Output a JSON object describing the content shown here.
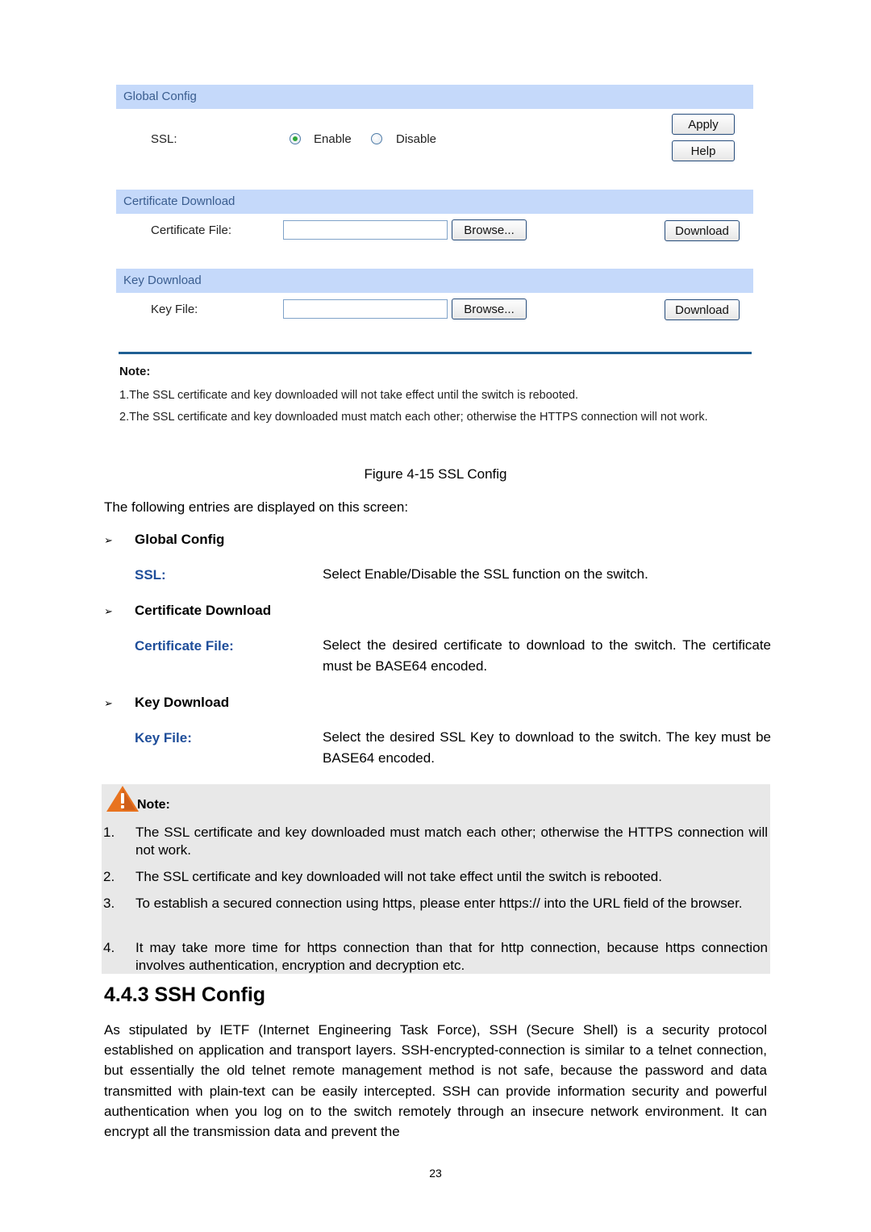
{
  "screenshot": {
    "global_config": {
      "header": "Global Config",
      "ssl_label": "SSL:",
      "options": [
        {
          "label": "Enable",
          "selected": true
        },
        {
          "label": "Disable",
          "selected": false
        }
      ],
      "apply_label": "Apply",
      "help_label": "Help"
    },
    "certificate_download": {
      "header": "Certificate Download",
      "field_label": "Certificate File:",
      "field_value": "",
      "browse_label": "Browse...",
      "download_label": "Download"
    },
    "key_download": {
      "header": "Key Download",
      "field_label": "Key File:",
      "field_value": "",
      "browse_label": "Browse...",
      "download_label": "Download"
    },
    "note": {
      "title": "Note:",
      "items": [
        "1.The SSL certificate and key downloaded will not take effect until the switch is rebooted.",
        "2.The SSL certificate and key downloaded must match each other; otherwise the HTTPS connection will not work."
      ]
    }
  },
  "document": {
    "figure_caption": "Figure 4-15 SSL Config",
    "intro": "The following entries are displayed on this screen:",
    "sections": [
      {
        "title": "Global Config",
        "entries": [
          {
            "term": "SSL:",
            "description": "Select Enable/Disable the SSL function on the switch."
          }
        ]
      },
      {
        "title": "Certificate Download",
        "entries": [
          {
            "term": "Certificate File:",
            "description": "Select the desired certificate to download to the switch. The certificate must be BASE64 encoded."
          }
        ]
      },
      {
        "title": "Key Download",
        "entries": [
          {
            "term": "Key File:",
            "description": "Select the desired SSL Key to download to the switch. The key must be BASE64 encoded."
          }
        ]
      }
    ],
    "note": {
      "label": "Note:",
      "items": [
        {
          "num": "1.",
          "text": "The SSL certificate and key downloaded must match each other; otherwise the HTTPS connection will not work."
        },
        {
          "num": "2.",
          "text": "The SSL certificate and key downloaded will not take effect until the switch is rebooted."
        },
        {
          "num": "3.",
          "text": "To establish a secured connection using https, please enter https:// into the URL field of the browser."
        },
        {
          "num": "4.",
          "text": "It may take more time for https connection than that for http connection, because https connection involves authentication, encryption and decryption etc."
        }
      ]
    },
    "heading": "4.4.3 SSH Config",
    "body": "As stipulated by IETF (Internet Engineering Task Force), SSH (Secure Shell) is a security protocol established on application and transport layers. SSH-encrypted-connection is similar to a telnet connection, but essentially the old telnet remote management method is not safe, because the password and data transmitted with plain-text can be easily intercepted. SSH can provide information security and powerful authentication when you log on to the switch remotely through an insecure network environment. It can encrypt all the transmission data and prevent the",
    "page_number": "23"
  },
  "icons": {
    "bullet": "arrowhead-bullet",
    "warning": "warning-triangle-icon"
  },
  "colors": {
    "header_bar": "#c5d9fa",
    "header_text": "#3a5d8f",
    "term_blue": "#1f4e9a",
    "note_bg": "#e8e8e8",
    "warning_orange": "#e8731f",
    "rule_blue": "#1f5f93"
  }
}
